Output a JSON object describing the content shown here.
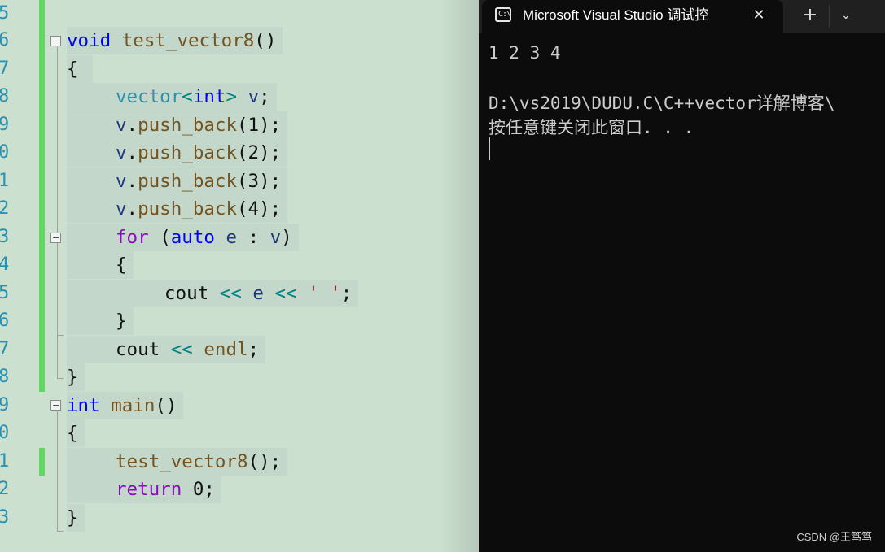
{
  "editor": {
    "line_numbers": [
      "5",
      "6",
      "7",
      "8",
      "9",
      "0",
      "1",
      "2",
      "3",
      "4",
      "5",
      "6",
      "7",
      "8",
      "9",
      "0",
      "1",
      "2",
      "3"
    ],
    "code": {
      "l6_kw": "void",
      "l6_fn": "test_vector8",
      "l6_punct": "()",
      "l7": "{",
      "l8_type": "vector",
      "l8_lt": "<",
      "l8_kw": "int",
      "l8_gt": ">",
      "l8_var": "v",
      "l8_semi": ";",
      "push_var": "v",
      "push_dot": ".",
      "push_fn": "push_back",
      "push_1": "(1);",
      "push_2": "(2);",
      "push_3": "(3);",
      "push_4": "(4);",
      "l13_kw": "for",
      "l13_open": "(",
      "l13_auto": "auto",
      "l13_e": "e",
      "l13_colon": ":",
      "l13_v": "v",
      "l13_close": ")",
      "l14": "{",
      "l15_cout": "cout",
      "l15_op1": "<<",
      "l15_e": "e",
      "l15_op2": "<<",
      "l15_str": "' '",
      "l15_semi": ";",
      "l16": "}",
      "l17_cout": "cout",
      "l17_op": "<<",
      "l17_endl": "endl",
      "l17_semi": ";",
      "l18": "}",
      "l19_kw": "int",
      "l19_fn": "main",
      "l19_punct": "()",
      "l20": "{",
      "l21_fn": "test_vector8",
      "l21_punct": "();",
      "l22_kw": "return",
      "l22_val": "0;",
      "l23": "}"
    }
  },
  "terminal": {
    "tab_title": "Microsoft Visual Studio 调试控",
    "tab_icon_glyph": "C:\\",
    "close_glyph": "✕",
    "new_tab_glyph": "+",
    "dropdown_glyph": "⌄",
    "output_line1": "1 2 3 4",
    "output_line2": "D:\\vs2019\\DUDU.C\\C++vector详解博客\\",
    "output_line3": "按任意键关闭此窗口. . ."
  },
  "watermark": "CSDN @王笃笃"
}
